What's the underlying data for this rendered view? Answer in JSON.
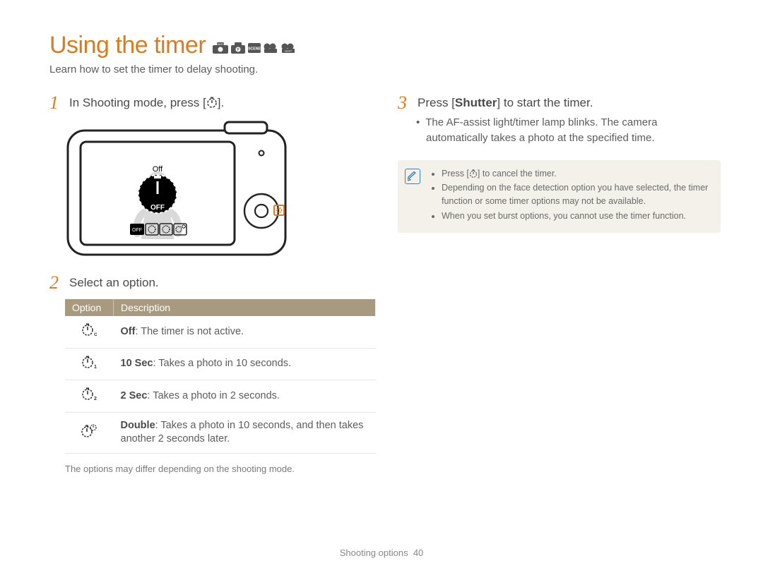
{
  "title": "Using the timer",
  "subtitle": "Learn how to set the timer to delay shooting.",
  "steps": {
    "s1": {
      "num": "1",
      "text_a": "In Shooting mode, press [",
      "text_b": "]."
    },
    "s2": {
      "num": "2",
      "text": "Select an option."
    },
    "s3": {
      "num": "3",
      "text_a": "Press [",
      "bold": "Shutter",
      "text_b": "] to start the timer."
    }
  },
  "s3_bullet": "The AF-assist light/timer lamp blinks. The camera automatically takes a photo at the specified time.",
  "table": {
    "headers": {
      "option": "Option",
      "desc": "Description"
    },
    "rows": [
      {
        "icon": "timer-off",
        "labelBold": "Off",
        "desc": ": The timer is not active."
      },
      {
        "icon": "timer-10",
        "labelBold": "10 Sec",
        "desc": ": Takes a photo in 10 seconds."
      },
      {
        "icon": "timer-2",
        "labelBold": "2 Sec",
        "desc": ": Takes a photo in 2 seconds."
      },
      {
        "icon": "timer-double",
        "labelBold": "Double",
        "desc": ": Takes a photo in 10 seconds, and then takes another 2 seconds later."
      }
    ]
  },
  "footnote": "The options may differ depending on the shooting mode.",
  "notes": {
    "n1_a": "Press [",
    "n1_b": "] to cancel the timer.",
    "n2": "Depending on the face detection option you have selected, the timer function or some timer options may not be available.",
    "n3": "When you set burst options, you cannot use the timer function."
  },
  "footer": {
    "section": "Shooting options",
    "page": "40"
  },
  "camera_screen_label": "Off",
  "camera_screen_big": "OFF"
}
